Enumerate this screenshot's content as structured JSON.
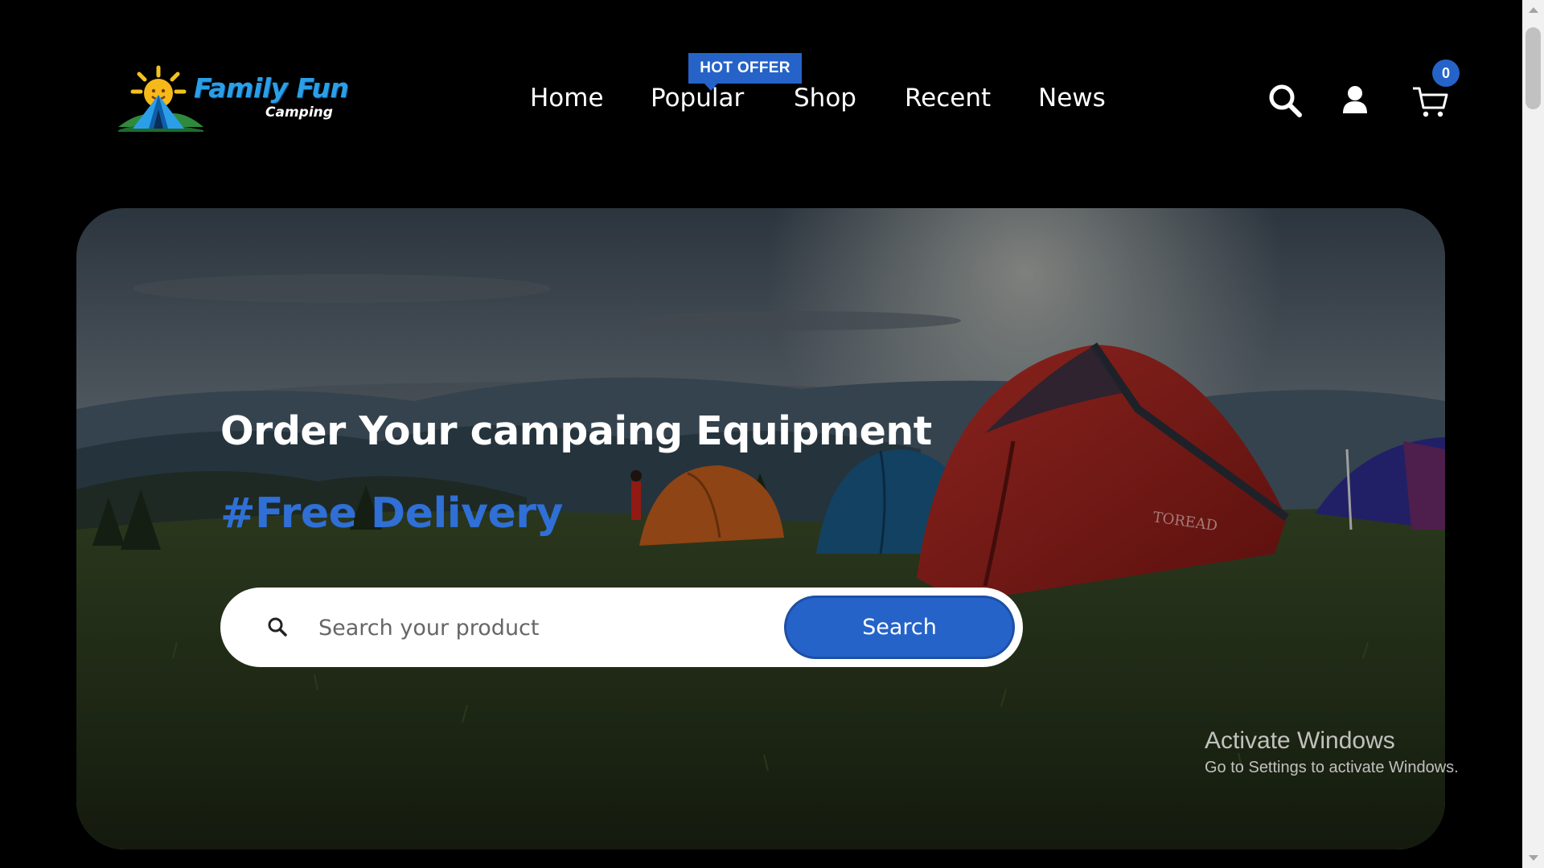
{
  "brand": {
    "name": "Family Fun",
    "tagline": "Camping"
  },
  "nav": {
    "items": [
      {
        "label": "Home"
      },
      {
        "label": "Popular"
      },
      {
        "label": "Shop"
      },
      {
        "label": "Recent"
      },
      {
        "label": "News"
      }
    ],
    "badge": "HOT OFFER"
  },
  "header_icons": {
    "search": "search-icon",
    "account": "user-icon",
    "cart": "cart-icon",
    "cart_count": "0"
  },
  "hero": {
    "title": "Order Your campaing Equipment",
    "tag": "#Free Delivery",
    "search": {
      "placeholder": "Search your product",
      "value": "",
      "button_label": "Search"
    },
    "tent_brand": "TOREAD"
  },
  "watermark": {
    "title": "Activate Windows",
    "subtitle": "Go to Settings to activate Windows."
  },
  "colors": {
    "background": "#000000",
    "accent": "#2563c9",
    "text": "#ffffff"
  }
}
